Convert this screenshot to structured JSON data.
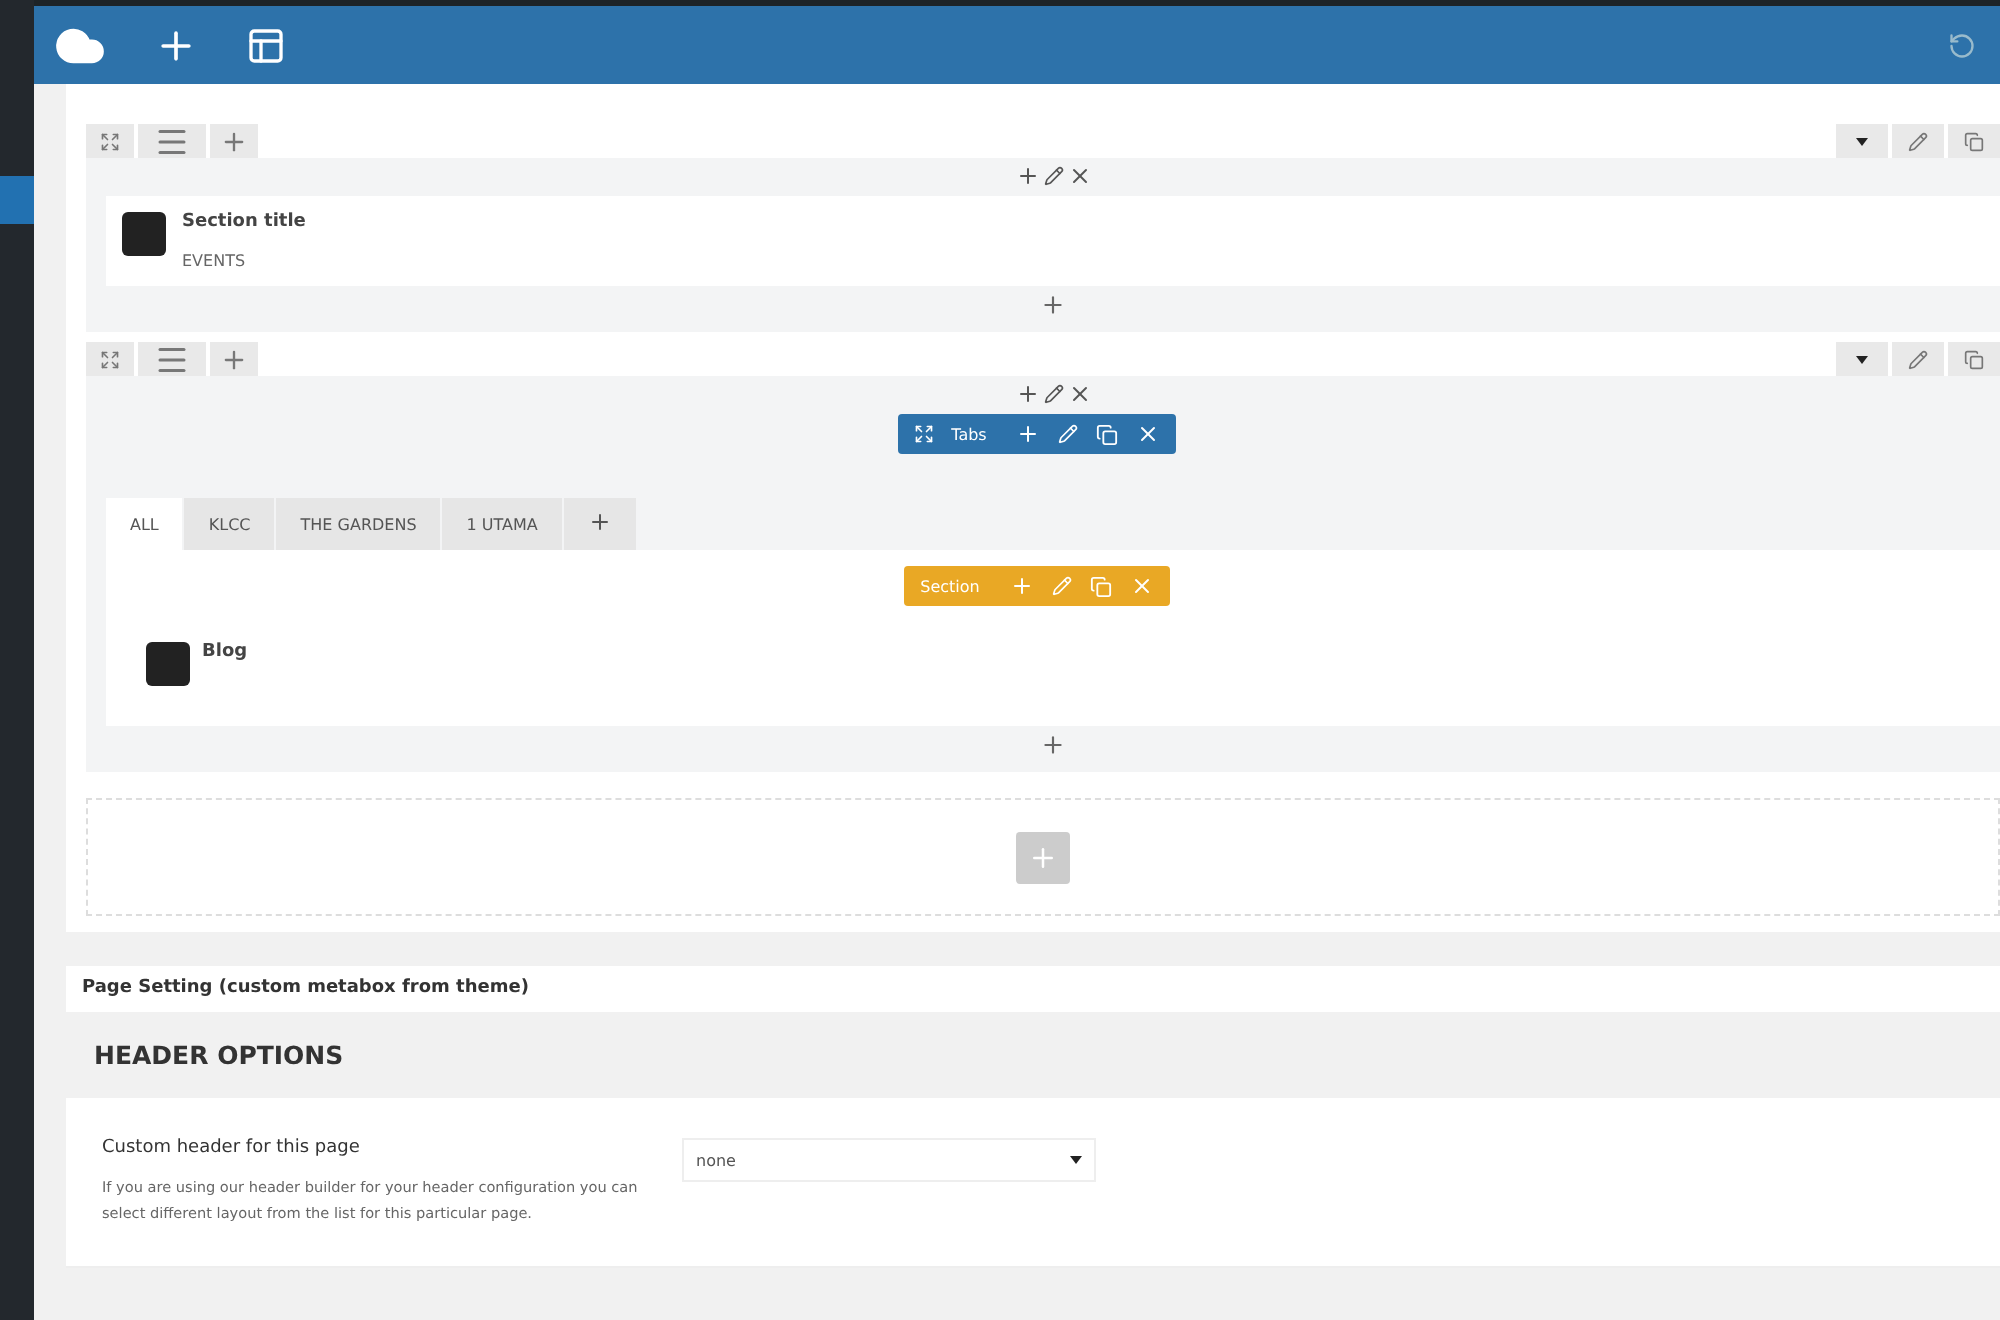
{
  "builder": {
    "rows": [
      {
        "kind": "element",
        "element": {
          "title": "Section title",
          "subtitle": "EVENTS"
        }
      },
      {
        "kind": "tabs",
        "tabs_label": "Tabs",
        "tabs": [
          {
            "label": "ALL",
            "selected": true
          },
          {
            "label": "KLCC",
            "selected": false
          },
          {
            "label": "THE GARDENS",
            "selected": false
          },
          {
            "label": "1 UTAMA",
            "selected": false
          }
        ],
        "section_label": "Section",
        "element": {
          "title": "Blog"
        }
      }
    ]
  },
  "page_setting": {
    "title": "Page Setting (custom metabox from theme)",
    "heading": "HEADER OPTIONS",
    "fields": [
      {
        "label": "Custom header for this page",
        "description": "If you are using our header builder for your header configuration you can select different layout from the list for this particular page.",
        "value": "none"
      }
    ]
  }
}
